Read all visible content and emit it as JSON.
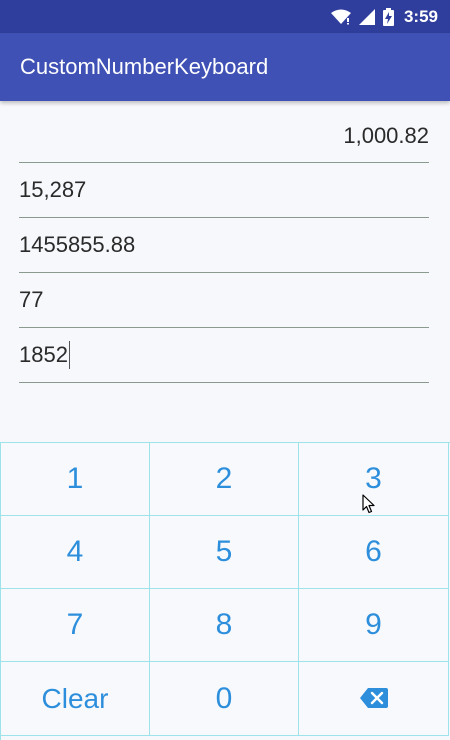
{
  "status_bar": {
    "time": "3:59",
    "icons": [
      "wifi-icon",
      "signal-icon",
      "battery-charging-icon"
    ]
  },
  "app_bar": {
    "title": "CustomNumberKeyboard"
  },
  "fields": [
    {
      "value": "1,000.82",
      "align": "right"
    },
    {
      "value": "15,287"
    },
    {
      "value": "1455855.88"
    },
    {
      "value": "77"
    },
    {
      "value": "1852",
      "focused": true
    }
  ],
  "keypad": {
    "keys": [
      "1",
      "2",
      "3",
      "4",
      "5",
      "6",
      "7",
      "8",
      "9",
      "Clear",
      "0"
    ],
    "backspace_icon": "backspace-icon",
    "text_color": "#2d8fdc",
    "border_color": "#9fe3ea"
  },
  "colors": {
    "primary": "#3f51b5",
    "primary_dark": "#2f3e9c"
  }
}
